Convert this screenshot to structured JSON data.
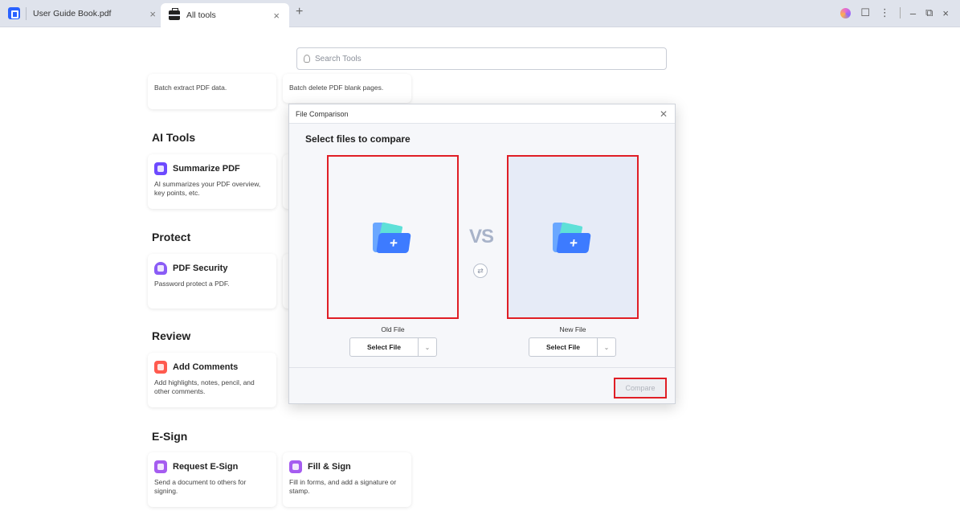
{
  "tabs": [
    {
      "label": "User Guide Book.pdf"
    },
    {
      "label": "All tools"
    }
  ],
  "search": {
    "placeholder": "Search Tools"
  },
  "sections": {
    "ai_tools": "AI Tools",
    "protect": "Protect",
    "review": "Review",
    "esign": "E-Sign"
  },
  "cards": {
    "batch_extract": {
      "desc": "Batch extract PDF data."
    },
    "batch_delete": {
      "desc": "Batch delete PDF blank pages."
    },
    "summarize": {
      "title": "Summarize PDF",
      "desc": "AI summarizes your PDF overview, key points, etc.",
      "color": "#6d4aff"
    },
    "security": {
      "title": "PDF Security",
      "desc": "Password protect a PDF.",
      "color": "#8a5cf6"
    },
    "comments": {
      "title": "Add Comments",
      "desc": "Add highlights, notes, pencil, and other comments.",
      "color": "#ff5a4e"
    },
    "request_esign": {
      "title": "Request E-Sign",
      "desc": "Send a document to others for signing.",
      "color": "#a55cf0"
    },
    "fill_sign": {
      "title": "Fill & Sign",
      "desc": "Fill in forms, and add a signature or stamp.",
      "color": "#a55cf0"
    }
  },
  "dialog": {
    "title": "File Comparison",
    "subtitle": "Select files to compare",
    "vs": "VS",
    "old_label": "Old File",
    "new_label": "New File",
    "select_file": "Select File",
    "compare": "Compare"
  },
  "accent": "#e01e25"
}
